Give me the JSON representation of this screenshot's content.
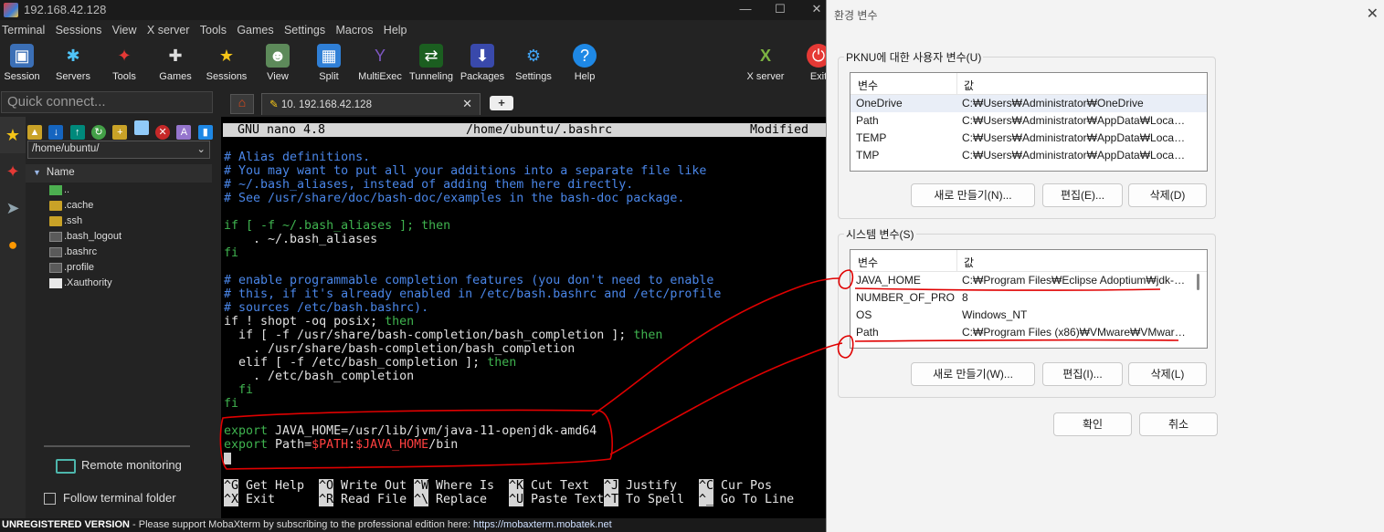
{
  "moba": {
    "window_title": "192.168.42.128",
    "menu": [
      "Terminal",
      "Sessions",
      "View",
      "X server",
      "Tools",
      "Games",
      "Settings",
      "Macros",
      "Help"
    ],
    "toolbar": [
      "Session",
      "Servers",
      "Tools",
      "Games",
      "Sessions",
      "View",
      "Split",
      "MultiExec",
      "Tunneling",
      "Packages",
      "Settings",
      "Help",
      "X server",
      "Exit"
    ],
    "quick_connect_placeholder": "Quick connect...",
    "tab_label": "10. 192.168.42.128",
    "tab_close": "✕",
    "tab_new": "+",
    "sftp": {
      "path": "/home/ubuntu/",
      "column": "Name",
      "files": [
        "..",
        ".cache",
        ".ssh",
        ".bash_logout",
        ".bashrc",
        ".profile",
        ".Xauthority"
      ],
      "remote_monitoring": "Remote monitoring",
      "follow_folder": "Follow terminal folder"
    },
    "status": {
      "unregistered": "UNREGISTERED VERSION",
      "message": " -  Please support MobaXterm by subscribing to the professional edition here: ",
      "link": "https://mobaxterm.mobatek.net"
    }
  },
  "nano": {
    "version": "GNU nano 4.8",
    "file": "/home/ubuntu/.bashrc",
    "state": "Modified",
    "lines": {
      "l1": "# Alias definitions.",
      "l2": "# You may want to put all your additions into a separate file like",
      "l3": "# ~/.bash_aliases, instead of adding them here directly.",
      "l4": "# See /usr/share/doc/bash-doc/examples in the bash-doc package.",
      "l6a": "if [ -f ~/.bash_aliases ]; ",
      "l6b": "then",
      "l7": "    . ~/.bash_aliases",
      "l8": "fi",
      "l10": "# enable programmable completion features (you don't need to enable",
      "l11": "# this, if it's already enabled in /etc/bash.bashrc and /etc/profile",
      "l12": "# sources /etc/bash.bashrc).",
      "l13a": "if ! shopt -oq posix; ",
      "l13b": "then",
      "l14a": "  if [ -f /usr/share/bash-completion/bash_completion ]; ",
      "l14b": "then",
      "l15": "    . /usr/share/bash-completion/bash_completion",
      "l16a": "  elif [ -f /etc/bash_completion ]; ",
      "l16b": "then",
      "l17": "    . /etc/bash_completion",
      "l18": "  fi",
      "l19": "fi",
      "l21a": "export ",
      "l21b": "JAVA_HOME=/usr/lib/jvm/java-11-openjdk-amd64",
      "l22a": "export ",
      "l22b": "Path=",
      "l22c": "$PATH",
      "l22d": ":",
      "l22e": "$JAVA_HOME",
      "l22f": "/bin"
    },
    "help": [
      {
        "k1": "^G",
        "t1": " Get Help",
        "k2": "^X",
        "t2": " Exit"
      },
      {
        "k1": "^O",
        "t1": " Write Out",
        "k2": "^R",
        "t2": " Read File"
      },
      {
        "k1": "^W",
        "t1": " Where Is",
        "k2": "^\\",
        "t2": " Replace"
      },
      {
        "k1": "^K",
        "t1": " Cut Text",
        "k2": "^U",
        "t2": " Paste Text"
      },
      {
        "k1": "^J",
        "t1": " Justify",
        "k2": "^T",
        "t2": " To Spell"
      },
      {
        "k1": "^C",
        "t1": " Cur Pos",
        "k2": "^_",
        "t2": " Go To Line"
      }
    ]
  },
  "env": {
    "title": "환경 변수",
    "user_group": "PKNU에 대한 사용자 변수(U)",
    "col_var": "변수",
    "col_val": "값",
    "user_vars": [
      {
        "name": "OneDrive",
        "value": "C:₩Users₩Administrator₩OneDrive"
      },
      {
        "name": "Path",
        "value": "C:₩Users₩Administrator₩AppData₩Local₩..."
      },
      {
        "name": "TEMP",
        "value": "C:₩Users₩Administrator₩AppData₩Local₩..."
      },
      {
        "name": "TMP",
        "value": "C:₩Users₩Administrator₩AppData₩Local₩..."
      }
    ],
    "user_buttons": {
      "new": "새로 만들기(N)...",
      "edit": "편집(E)...",
      "delete": "삭제(D)"
    },
    "system_group": "시스템 변수(S)",
    "system_vars": [
      {
        "name": "JAVA_HOME",
        "value": "C:₩Program Files₩Eclipse Adoptium₩jdk-1..."
      },
      {
        "name": "NUMBER_OF_PRO...",
        "value": "8"
      },
      {
        "name": "OS",
        "value": "Windows_NT"
      },
      {
        "name": "Path",
        "value": "C:₩Program Files (x86)₩VMware₩VMware..."
      }
    ],
    "system_buttons": {
      "new": "새로 만들기(W)...",
      "edit": "편집(I)...",
      "delete": "삭제(L)"
    },
    "ok": "확인",
    "cancel": "취소"
  }
}
